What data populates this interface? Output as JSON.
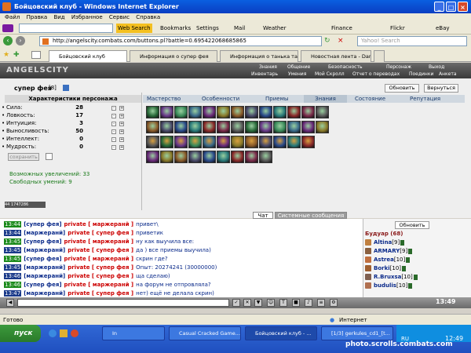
{
  "window": {
    "title": "Бойцовский клуб - Windows Internet Explorer"
  },
  "menu": [
    "Файл",
    "Правка",
    "Вид",
    "Избранное",
    "Сервис",
    "Справка"
  ],
  "toolbar1": {
    "web_search": "Web Search",
    "bookmarks": "Bookmarks",
    "settings": "Settings",
    "mail": "Mail",
    "weather": "Weather",
    "finance": "Finance",
    "flickr": "Flickr",
    "ebay": "eBay"
  },
  "address": {
    "url": "http://angelscity.combats.com/buttons.pl?battle=0.695422068685865",
    "search_placeholder": "Yahoo! Search"
  },
  "tabs": [
    "Бойцовский клуб",
    "Информация о супер фея",
    "Информация о танька танк",
    "Новостная лента - DarkClan"
  ],
  "game": {
    "logo": "ANGELSCITY",
    "nav_top": [
      "Знания",
      "Общение",
      "Безопасность",
      "Персонаж",
      "Выход"
    ],
    "nav_bottom": [
      "Инвентарь",
      "Умения",
      "Мой Скролл",
      "Отчет о переводах",
      "Поединки",
      "Анкета"
    ],
    "char_name": "супер фея",
    "char_level": "[8]",
    "refresh_btn": "Обновить",
    "return_btn": "Вернуться",
    "stats_header": "Характеристики персонажа",
    "stats": [
      {
        "name": "Сила:",
        "value": "28"
      },
      {
        "name": "Ловкость:",
        "value": "17"
      },
      {
        "name": "Интуиция:",
        "value": "3"
      },
      {
        "name": "Выносливость:",
        "value": "50"
      },
      {
        "name": "Интеллект:",
        "value": "0"
      },
      {
        "name": "Мудрость:",
        "value": "0"
      }
    ],
    "save_btn": "сохранить",
    "possible_increases": "Возможных увеличений: 33",
    "free_skills": "Свободных умений: 9",
    "skill_tabs": [
      "Мастерство",
      "Особенности",
      "Приемы",
      "Знания",
      "Состояние",
      "Репутация"
    ],
    "counter": "44 1747286"
  },
  "chat": {
    "tab_chat": "Чат",
    "tab_system": "Системные сообщения",
    "lines": [
      {
        "time": "13:44",
        "from": "[супер фея]",
        "priv": "private [ маржеранй ]",
        "msg": "привет\\",
        "green": true
      },
      {
        "time": "13:44",
        "from": "[маржеранй]",
        "priv": "private [ супер фея ]",
        "msg": "приветик",
        "green": false
      },
      {
        "time": "13:45",
        "from": "[супер фея]",
        "priv": "private [ маржеранй ]",
        "msg": "ну как выучила все:",
        "green": true
      },
      {
        "time": "13:45",
        "from": "[маржеранй]",
        "priv": "private [ супер фея ]",
        "msg": "да ) все приемы выучила)",
        "green": false
      },
      {
        "time": "13:45",
        "from": "[супер фея]",
        "priv": "private [ маржеранй ]",
        "msg": "скрин где?",
        "green": true
      },
      {
        "time": "13:45",
        "from": "[маржеранй]",
        "priv": "private [ супер фея ]",
        "msg": "Опыт: 20274241 (30000000)",
        "green": false
      },
      {
        "time": "13:46",
        "from": "[маржеранй]",
        "priv": "private [ супер фея ]",
        "msg": "ща сделаю)",
        "green": false
      },
      {
        "time": "13:46",
        "from": "[супер фея]",
        "priv": "private [ маржеранй ]",
        "msg": "на форум не отпровляла?",
        "green": true
      },
      {
        "time": "13:47",
        "from": "[маржеранй]",
        "priv": "private [ супер фея ]",
        "msg": "нет) ещё не делала скрин)",
        "green": false
      }
    ]
  },
  "users": {
    "refresh": "Обновить",
    "room": "Будуар (68)",
    "list": [
      {
        "name": "Altina",
        "lvl": "[9]"
      },
      {
        "name": "ARMARY",
        "lvl": "[9]"
      },
      {
        "name": "Astrea",
        "lvl": "[10]"
      },
      {
        "name": "Borki",
        "lvl": "[10]"
      },
      {
        "name": "R.Bruxsa",
        "lvl": "[10]"
      },
      {
        "name": "budulis",
        "lvl": "[10]"
      }
    ]
  },
  "game_clock": "13:49",
  "status": {
    "left": "Готово",
    "zone": "Интернет"
  },
  "taskbar": {
    "start": "пуск",
    "tasks": [
      "In",
      "Casual Cracked Game...",
      "Бойцовский клуб - ...",
      "[1/3] gerkules_cd1_[t..."
    ],
    "lang": "RU",
    "clock": "12:49"
  },
  "watermark": "photo.scrolls.combats.com"
}
